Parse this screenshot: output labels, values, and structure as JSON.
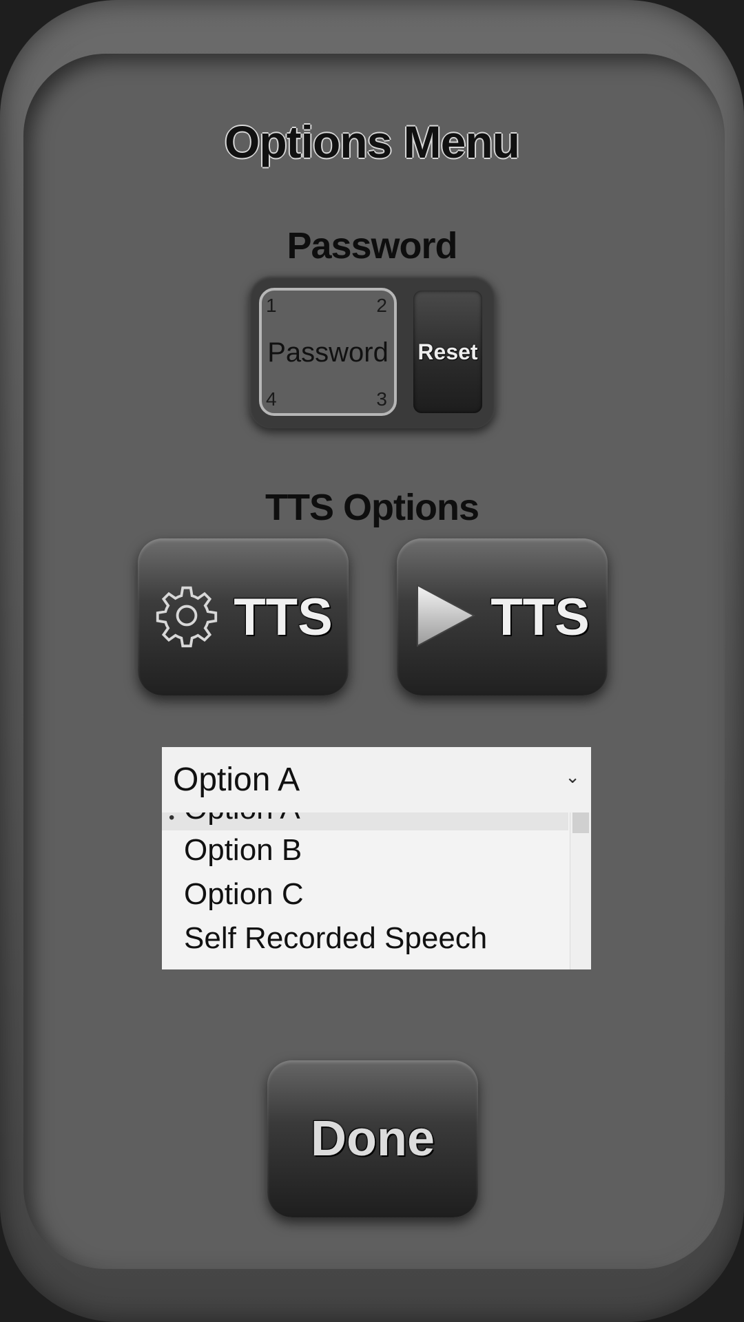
{
  "menu": {
    "title": "Options Menu"
  },
  "password": {
    "section_label": "Password",
    "field_label": "Password",
    "corners": {
      "top_left": "1",
      "top_right": "2",
      "bottom_right": "3",
      "bottom_left": "4"
    },
    "reset_label": "Reset"
  },
  "tts": {
    "section_label": "TTS Options",
    "settings_button": {
      "label": "TTS",
      "icon": "gear-icon"
    },
    "play_button": {
      "label": "TTS",
      "icon": "play-icon"
    }
  },
  "voice_select": {
    "selected_value": "Option A",
    "chevron_icon": "chevron-down-icon",
    "options": [
      "Option A",
      "Option B",
      "Option C",
      "Self Recorded Speech"
    ]
  },
  "done_button": {
    "label": "Done"
  }
}
